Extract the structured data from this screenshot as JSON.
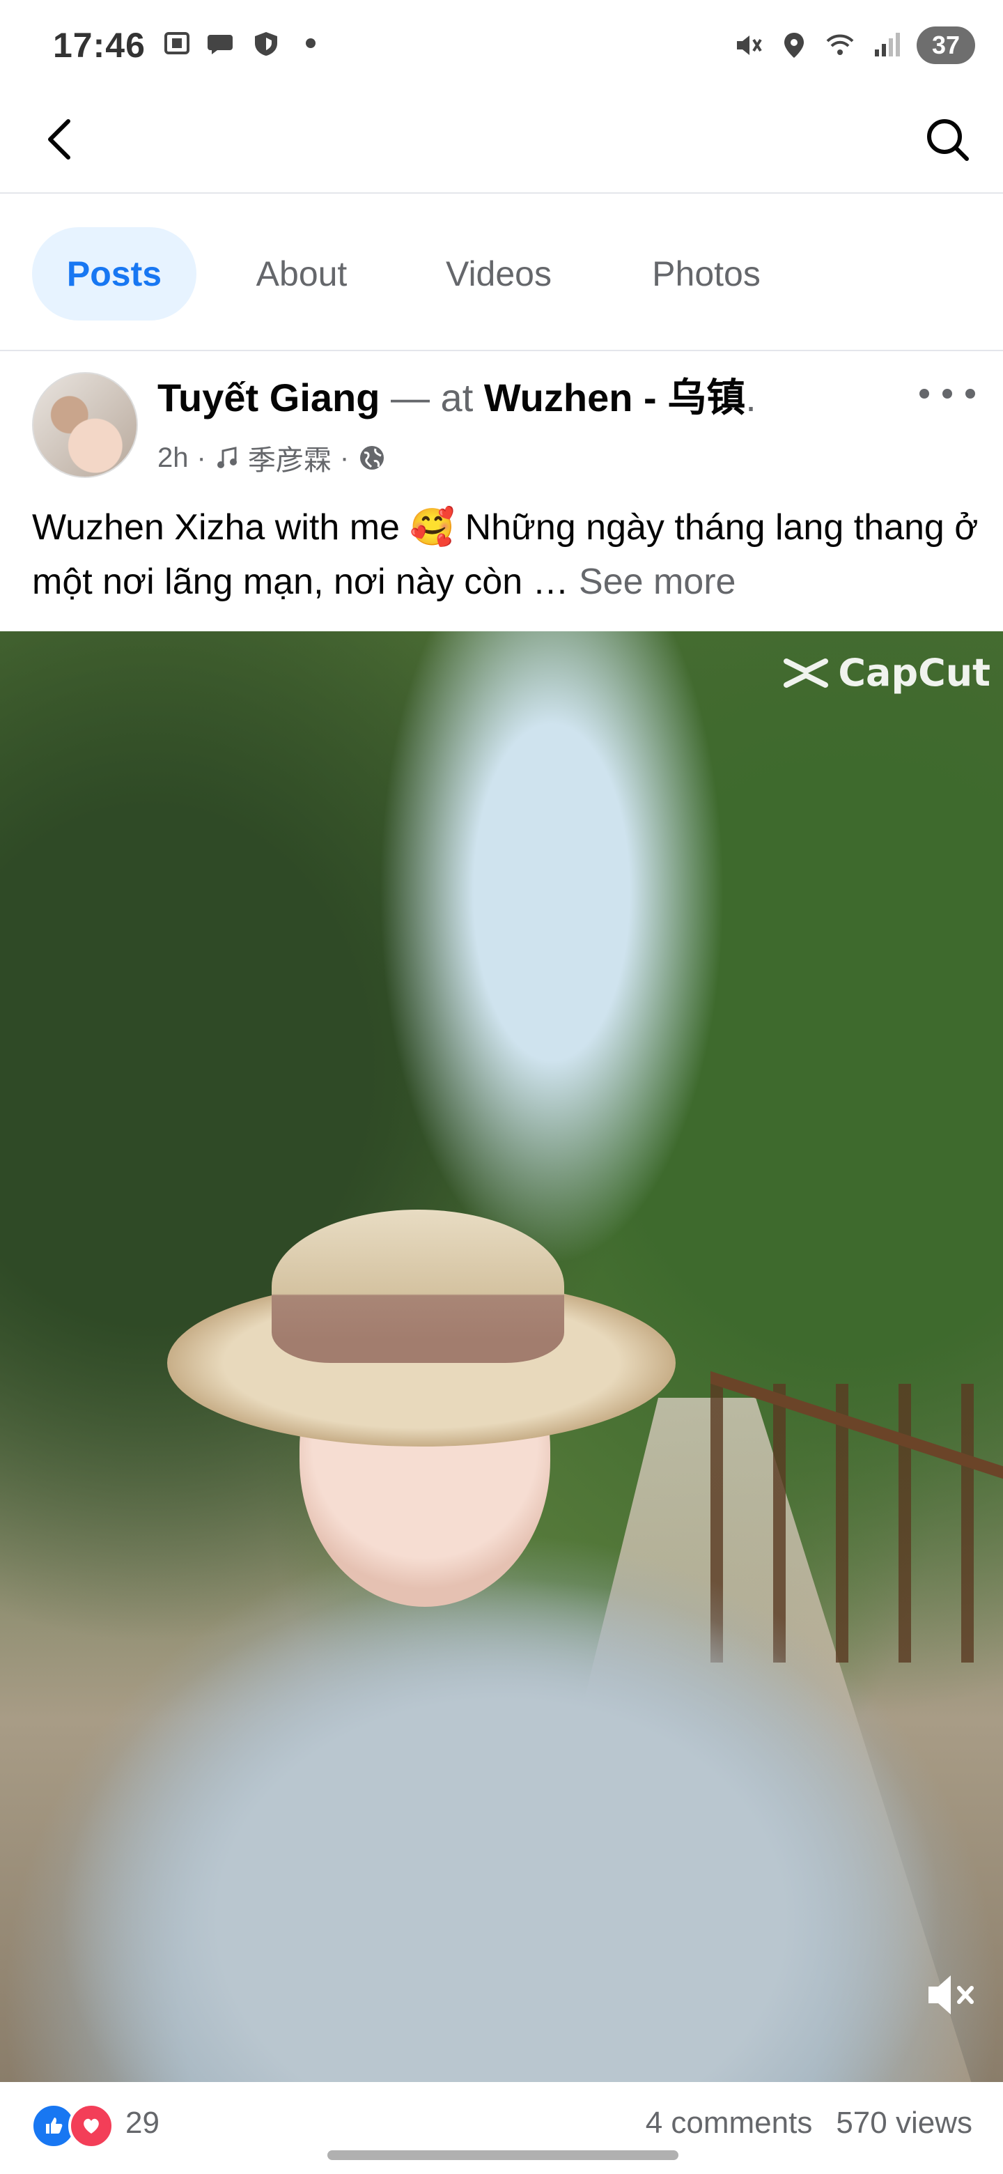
{
  "status_bar": {
    "time": "17:46",
    "battery": "37",
    "left_icons": [
      "screenshot-icon",
      "chat-bubble-icon",
      "shield-icon",
      "dot-icon"
    ],
    "right_icons": [
      "mute-icon",
      "location-icon",
      "wifi-icon",
      "signal-icon"
    ]
  },
  "nav": {
    "back_icon": "back-arrow-icon",
    "search_icon": "search-icon"
  },
  "tabs": [
    {
      "label": "Posts",
      "active": true
    },
    {
      "label": "About",
      "active": false
    },
    {
      "label": "Videos",
      "active": false
    },
    {
      "label": "Photos",
      "active": false
    }
  ],
  "post": {
    "author": "Tuyết Giang",
    "separator": " — at ",
    "place": "Wuzhen - 乌镇",
    "place_suffix": ".",
    "time": "2h",
    "music": "季彦霖",
    "dot": "·",
    "caption_text": "Wuzhen Xizha with me 🥰 Những ngày tháng lang thang ở một nơi lãng mạn, nơi này còn … ",
    "see_more": "See more"
  },
  "video": {
    "watermark": "CapCut",
    "muted": true
  },
  "footer": {
    "reaction_count": "29",
    "comments": "4 comments",
    "views": "570 views",
    "accent": "#1877f2",
    "love_color": "#f33e58"
  }
}
